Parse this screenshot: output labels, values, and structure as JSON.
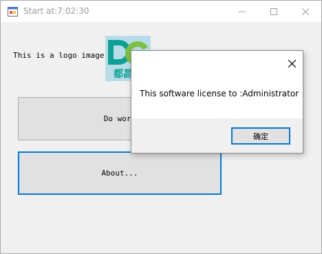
{
  "window": {
    "title": "Start at:7:02:30",
    "icon": "winforms-app-icon",
    "controls": [
      "minimize-icon",
      "maximize-icon",
      "close-icon"
    ]
  },
  "main": {
    "logo_label": "This is a logo image:",
    "logo": {
      "letters": "DC",
      "caption": "都昌信"
    },
    "do_work_label": "Do work",
    "about_label": "About..."
  },
  "dialog": {
    "message": "This software license to :Administrator",
    "ok_label": "确定"
  },
  "colors": {
    "accent": "#0078d7",
    "logo_teal": "#0e9f96",
    "logo_green": "#7cc142",
    "logo_bg": "#b8dde8"
  }
}
